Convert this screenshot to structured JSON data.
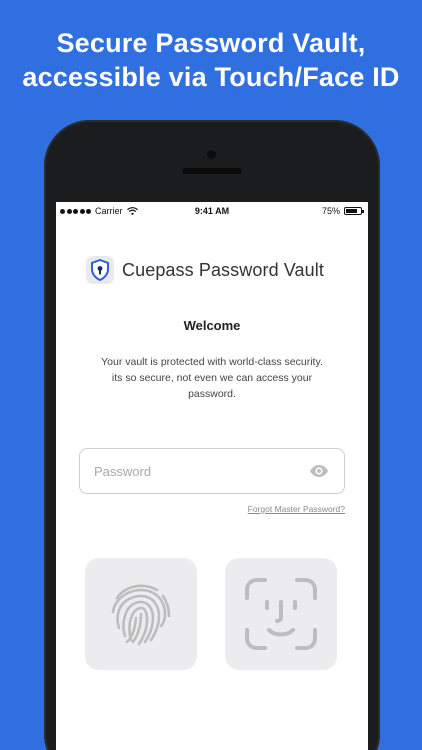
{
  "headline": {
    "line1": "Secure Password Vault,",
    "line2": "accessible via Touch/Face ID"
  },
  "status_bar": {
    "carrier": "Carrier",
    "time": "9:41 AM",
    "battery": "75%",
    "battery_level": 0.75
  },
  "app": {
    "name": "Cuepass Password Vault",
    "logo_icon": "shield-keyhole-icon"
  },
  "login": {
    "welcome": "Welcome",
    "description": "Your vault is protected with world-class security. its so secure, not even we can access your password.",
    "password_placeholder": "Password",
    "password_value": "",
    "show_password_icon": "eye-icon",
    "forgot_link": "Forgot Master Password?"
  },
  "biometrics": {
    "touch_id_icon": "fingerprint-icon",
    "face_id_icon": "face-id-icon"
  },
  "colors": {
    "background": "#2f6fe0",
    "phone": "#1b1c1e",
    "brand_icon": "#2f5fd0",
    "tile": "#ececee"
  }
}
